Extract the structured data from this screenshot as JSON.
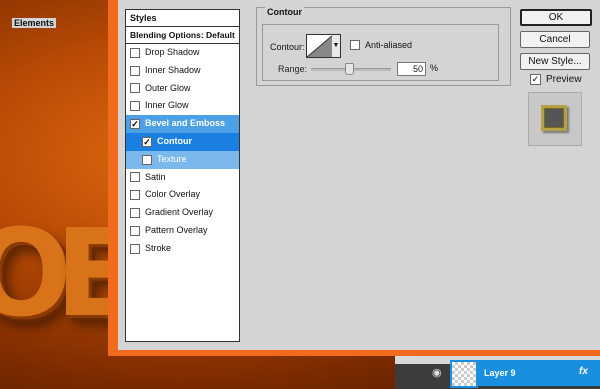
{
  "styles_panel": {
    "header": "Styles",
    "blending_options": "Blending Options: Default",
    "items": [
      {
        "label": "Drop Shadow",
        "checked": false
      },
      {
        "label": "Inner Shadow",
        "checked": false
      },
      {
        "label": "Outer Glow",
        "checked": false
      },
      {
        "label": "Inner Glow",
        "checked": false
      },
      {
        "label": "Bevel and Emboss",
        "checked": true
      },
      {
        "label": "Contour",
        "checked": true
      },
      {
        "label": "Texture",
        "checked": false
      },
      {
        "label": "Satin",
        "checked": false
      },
      {
        "label": "Color Overlay",
        "checked": false
      },
      {
        "label": "Gradient Overlay",
        "checked": false
      },
      {
        "label": "Pattern Overlay",
        "checked": false
      },
      {
        "label": "Stroke",
        "checked": false
      }
    ]
  },
  "contour_section": {
    "title": "Contour",
    "elements_title": "Elements",
    "contour_label": "Contour:",
    "anti_aliased_label": "Anti-aliased",
    "anti_aliased_checked": false,
    "range_label": "Range:",
    "range_value": "50",
    "range_unit": "%",
    "range_slider_level": 0.5
  },
  "buttons": {
    "ok": "OK",
    "cancel": "Cancel",
    "new_style": "New Style..."
  },
  "preview": {
    "label": "Preview",
    "checked": true
  },
  "layers": {
    "layer_name": "Layer 9",
    "fx_label": "fx"
  },
  "colors": {
    "dialog_border": "#f26b1d",
    "selection_blue": "#1a7fe0",
    "bevel_highlight": "#4ca0e6"
  }
}
